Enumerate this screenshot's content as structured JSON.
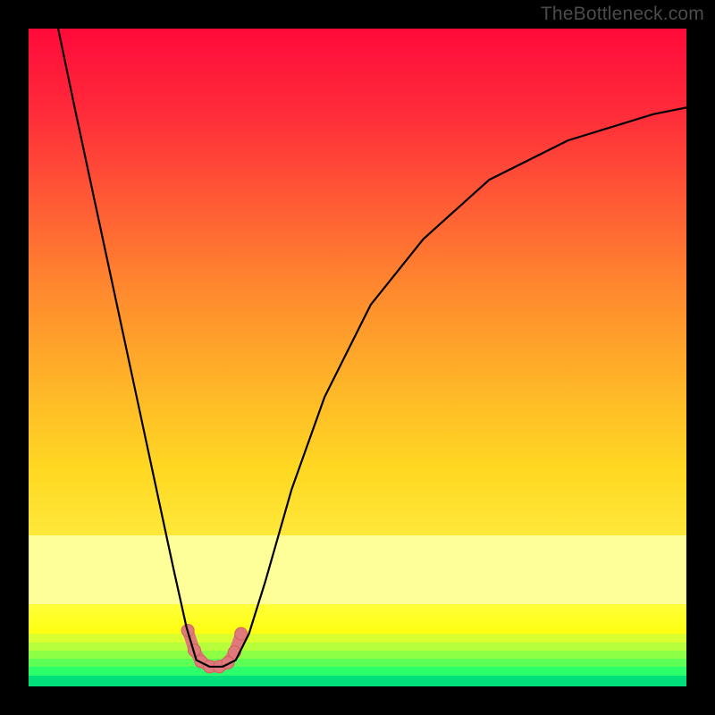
{
  "watermark": "TheBottleneck.com",
  "chart_data": {
    "type": "line",
    "title": "",
    "xlabel": "",
    "ylabel": "",
    "xlim": [
      0,
      100
    ],
    "ylim": [
      0,
      100
    ],
    "legend": false,
    "grid": false,
    "background": {
      "style": "vertical-gradient",
      "stops": [
        {
          "pos": 0.0,
          "color": "#ff0a3a"
        },
        {
          "pos": 0.35,
          "color": "#ff6a32"
        },
        {
          "pos": 0.68,
          "color": "#ffc820"
        },
        {
          "pos": 0.77,
          "color": "#ffe83a"
        },
        {
          "pos": 0.82,
          "color": "#ffff9a"
        },
        {
          "pos": 0.9,
          "color": "#ffff20"
        },
        {
          "pos": 0.94,
          "color": "#b7ff3a"
        },
        {
          "pos": 0.97,
          "color": "#5dff55"
        },
        {
          "pos": 1.0,
          "color": "#00e07a"
        }
      ]
    },
    "series": [
      {
        "name": "bottleneck-curve",
        "color": "#000000",
        "stroke_width_px": 2.2,
        "x": [
          4.5,
          7,
          10,
          13,
          16,
          19,
          22,
          24,
          25.5,
          27.5,
          29.5,
          31.5,
          33.5,
          36,
          40,
          45,
          52,
          60,
          70,
          82,
          95,
          100
        ],
        "y": [
          100,
          88,
          74,
          60,
          46,
          32,
          18,
          9,
          4,
          3,
          3,
          4,
          8,
          16,
          30,
          44,
          58,
          68,
          77,
          83,
          87,
          88
        ]
      }
    ],
    "markers": [
      {
        "name": "highlight-dots",
        "color": "#e07a7a",
        "radius_px": 7,
        "stroke": "#d06060",
        "points_xy": [
          [
            24.2,
            8.5
          ],
          [
            25.2,
            5.5
          ],
          [
            26.2,
            3.8
          ],
          [
            27.5,
            3.0
          ],
          [
            29.0,
            3.0
          ],
          [
            30.3,
            3.6
          ],
          [
            31.3,
            5.2
          ],
          [
            32.3,
            8.0
          ]
        ]
      },
      {
        "name": "highlight-arc",
        "type": "stroke",
        "color": "#e07a7a",
        "stroke_width_px": 13,
        "points_xy": [
          [
            24.2,
            8.5
          ],
          [
            25.2,
            5.5
          ],
          [
            26.2,
            3.8
          ],
          [
            27.5,
            3.0
          ],
          [
            29.0,
            3.0
          ],
          [
            30.3,
            3.6
          ],
          [
            31.3,
            5.2
          ],
          [
            32.3,
            8.0
          ]
        ]
      }
    ]
  }
}
